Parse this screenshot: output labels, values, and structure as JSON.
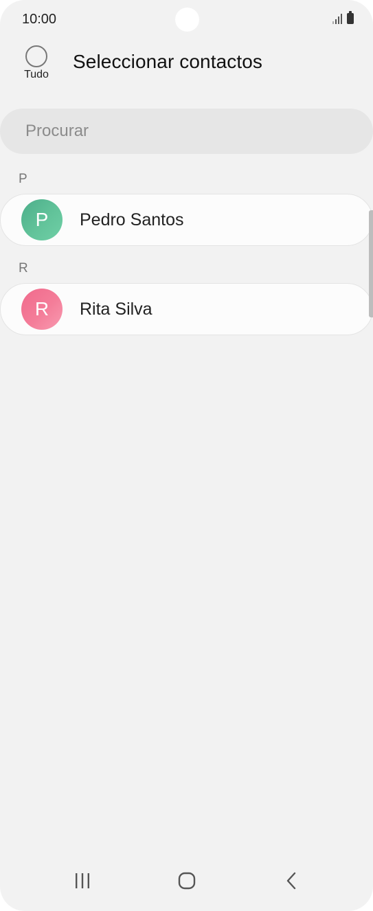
{
  "status_bar": {
    "time": "10:00",
    "icons": [
      "signal-icon",
      "battery-icon"
    ]
  },
  "header": {
    "select_all_label": "Tudo",
    "title": "Seleccionar contactos"
  },
  "search": {
    "placeholder": "Procurar"
  },
  "sections": [
    {
      "letter": "P",
      "contacts": [
        {
          "initial": "P",
          "name": "Pedro Santos",
          "avatar_color": "#5fbf98"
        }
      ]
    },
    {
      "letter": "R",
      "contacts": [
        {
          "initial": "R",
          "name": "Rita Silva",
          "avatar_color": "#f37b98"
        }
      ]
    }
  ],
  "nav_bar": {
    "buttons": [
      "recents-icon",
      "home-icon",
      "back-icon"
    ]
  },
  "colors": {
    "background": "#f2f2f2",
    "search_field": "#e6e6e6",
    "card": "#fcfcfc"
  }
}
